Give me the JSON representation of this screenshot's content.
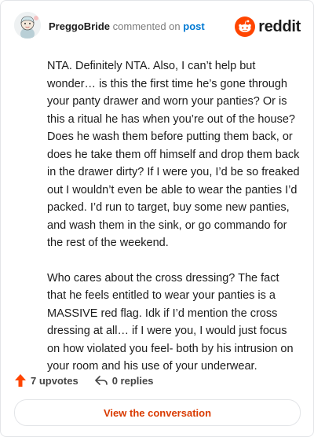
{
  "header": {
    "username": "PreggoBride",
    "action_text": "commented on",
    "link_text": "post",
    "brand_name": "reddit",
    "brand_color": "#ff4500"
  },
  "comment": {
    "paragraphs": [
      "NTA. Definitely NTA. Also, I can’t help but wonder… is this the first time he’s gone through your panty drawer and worn your panties? Or is this a ritual he has when you’re out of the house? Does he wash them before putting them back, or does he take them off himself and drop them back in the drawer dirty? If I were you, I’d be so freaked out I wouldn’t even be able to wear the panties I’d packed. I’d run to target, buy some new panties, and wash them in the sink, or go commando for the rest of the weekend.",
      "Who cares about the cross dressing? The fact that he feels entitled to wear your panties is a MASSIVE red flag. Idk if I’d mention the cross dressing at all… if I were you, I would just focus on how violated you feel- both by his intrusion on your room and his use of your underwear."
    ]
  },
  "actions": {
    "upvotes": "7 upvotes",
    "replies": "0 replies",
    "upvote_icon": "upvote-arrow-icon",
    "reply_icon": "reply-arrow-icon",
    "upvote_color": "#ff4500"
  },
  "cta": {
    "label": "View the conversation",
    "color": "#d93a00"
  }
}
